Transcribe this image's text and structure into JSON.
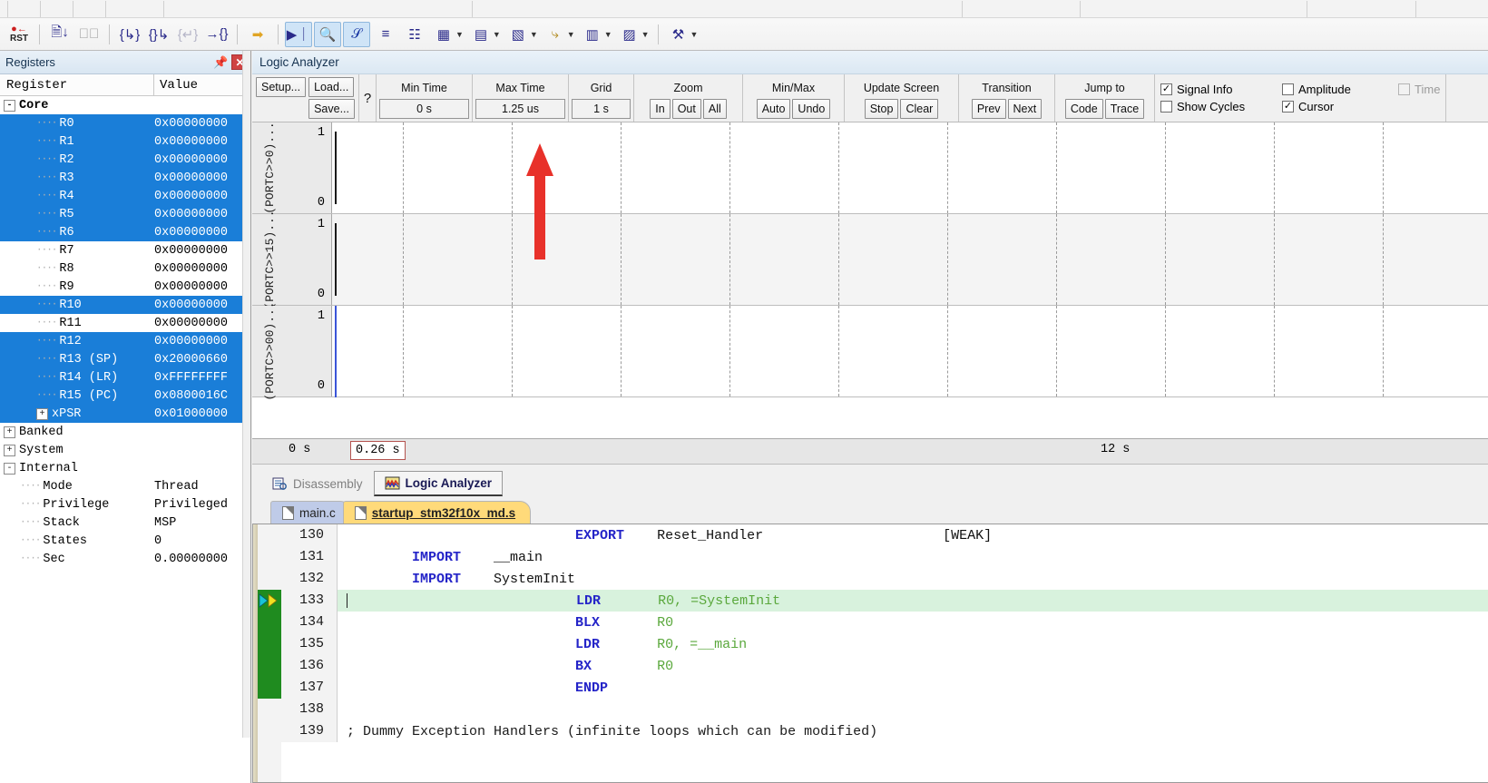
{
  "toolbar": {
    "buttons": [
      {
        "name": "reset-cpu",
        "glyph": "RST"
      },
      {
        "name": "run-to-cursor",
        "glyph": "⤓"
      },
      {
        "name": "stop",
        "glyph": "⊗"
      },
      {
        "name": "step",
        "glyph": "{↴}"
      },
      {
        "name": "step-over",
        "glyph": "{}↴"
      },
      {
        "name": "step-out",
        "glyph": "{↷}"
      },
      {
        "name": "run-to-line",
        "glyph": "→{}"
      },
      {
        "name": "show-next-statement",
        "glyph": "⇨"
      },
      {
        "name": "command-window",
        "glyph": "▶"
      },
      {
        "name": "disassembly-window",
        "glyph": "⌕"
      },
      {
        "name": "symbols-window",
        "glyph": "S"
      },
      {
        "name": "registers-window",
        "glyph": "≡"
      },
      {
        "name": "call-stack-window",
        "glyph": "⚭"
      },
      {
        "name": "watch-windows",
        "glyph": "▦"
      },
      {
        "name": "memory-windows",
        "glyph": "▤"
      },
      {
        "name": "serial-windows",
        "glyph": "▧"
      },
      {
        "name": "analysis-windows",
        "glyph": "⤵"
      },
      {
        "name": "trace-windows",
        "glyph": "▥"
      },
      {
        "name": "system-viewer",
        "glyph": "▨"
      },
      {
        "name": "toolbox",
        "glyph": "⚒"
      }
    ]
  },
  "registers": {
    "title": "Registers",
    "pin_icon": "pin-icon",
    "close_icon": "close-icon",
    "columns": [
      "Register",
      "Value"
    ],
    "rows": [
      {
        "name": "Core",
        "value": "",
        "level": 0,
        "toggle": "-",
        "selected": false,
        "bold": true
      },
      {
        "name": "R0",
        "value": "0x00000000",
        "level": 2,
        "toggle": "",
        "selected": true,
        "bold": false
      },
      {
        "name": "R1",
        "value": "0x00000000",
        "level": 2,
        "toggle": "",
        "selected": true,
        "bold": false
      },
      {
        "name": "R2",
        "value": "0x00000000",
        "level": 2,
        "toggle": "",
        "selected": true,
        "bold": false
      },
      {
        "name": "R3",
        "value": "0x00000000",
        "level": 2,
        "toggle": "",
        "selected": true,
        "bold": false
      },
      {
        "name": "R4",
        "value": "0x00000000",
        "level": 2,
        "toggle": "",
        "selected": true,
        "bold": false
      },
      {
        "name": "R5",
        "value": "0x00000000",
        "level": 2,
        "toggle": "",
        "selected": true,
        "bold": false
      },
      {
        "name": "R6",
        "value": "0x00000000",
        "level": 2,
        "toggle": "",
        "selected": true,
        "bold": false
      },
      {
        "name": "R7",
        "value": "0x00000000",
        "level": 2,
        "toggle": "",
        "selected": false,
        "bold": false
      },
      {
        "name": "R8",
        "value": "0x00000000",
        "level": 2,
        "toggle": "",
        "selected": false,
        "bold": false
      },
      {
        "name": "R9",
        "value": "0x00000000",
        "level": 2,
        "toggle": "",
        "selected": false,
        "bold": false
      },
      {
        "name": "R10",
        "value": "0x00000000",
        "level": 2,
        "toggle": "",
        "selected": true,
        "bold": false
      },
      {
        "name": "R11",
        "value": "0x00000000",
        "level": 2,
        "toggle": "",
        "selected": false,
        "bold": false
      },
      {
        "name": "R12",
        "value": "0x00000000",
        "level": 2,
        "toggle": "",
        "selected": true,
        "bold": false
      },
      {
        "name": "R13 (SP)",
        "value": "0x20000660",
        "level": 2,
        "toggle": "",
        "selected": true,
        "bold": false
      },
      {
        "name": "R14 (LR)",
        "value": "0xFFFFFFFF",
        "level": 2,
        "toggle": "",
        "selected": true,
        "bold": false
      },
      {
        "name": "R15 (PC)",
        "value": "0x0800016C",
        "level": 2,
        "toggle": "",
        "selected": true,
        "bold": false
      },
      {
        "name": "xPSR",
        "value": "0x01000000",
        "level": 2,
        "toggle": "+",
        "selected": true,
        "bold": false
      },
      {
        "name": "Banked",
        "value": "",
        "level": 0,
        "toggle": "+",
        "selected": false,
        "bold": false
      },
      {
        "name": "System",
        "value": "",
        "level": 0,
        "toggle": "+",
        "selected": false,
        "bold": false
      },
      {
        "name": "Internal",
        "value": "",
        "level": 0,
        "toggle": "-",
        "selected": false,
        "bold": false
      },
      {
        "name": "Mode",
        "value": "Thread",
        "level": 1,
        "toggle": "",
        "selected": false,
        "bold": false
      },
      {
        "name": "Privilege",
        "value": "Privileged",
        "level": 1,
        "toggle": "",
        "selected": false,
        "bold": false
      },
      {
        "name": "Stack",
        "value": "MSP",
        "level": 1,
        "toggle": "",
        "selected": false,
        "bold": false
      },
      {
        "name": "States",
        "value": "0",
        "level": 1,
        "toggle": "",
        "selected": false,
        "bold": false
      },
      {
        "name": "Sec",
        "value": "0.00000000",
        "level": 1,
        "toggle": "",
        "selected": false,
        "bold": false
      }
    ]
  },
  "logic_analyzer": {
    "title": "Logic Analyzer",
    "setup_label": "Setup...",
    "load_label": "Load...",
    "save_label": "Save...",
    "help_label": "?",
    "groups": [
      {
        "label": "Min Time",
        "value": "0 s"
      },
      {
        "label": "Max Time",
        "value": "1.25 us"
      },
      {
        "label": "Grid",
        "value": "1 s"
      }
    ],
    "button_groups": [
      {
        "label": "Zoom",
        "buttons": [
          "In",
          "Out",
          "All"
        ]
      },
      {
        "label": "Min/Max",
        "buttons": [
          "Auto",
          "Undo"
        ]
      },
      {
        "label": "Update Screen",
        "buttons": [
          "Stop",
          "Clear"
        ]
      },
      {
        "label": "Transition",
        "buttons": [
          "Prev",
          "Next"
        ]
      },
      {
        "label": "Jump to",
        "buttons": [
          "Code",
          "Trace"
        ]
      }
    ],
    "checkboxes": [
      {
        "label": "Signal Info",
        "checked": true,
        "disabled": false
      },
      {
        "label": "Amplitude",
        "checked": false,
        "disabled": false
      },
      {
        "label": "Time",
        "checked": false,
        "disabled": true
      },
      {
        "label": "Show Cycles",
        "checked": false,
        "disabled": false
      },
      {
        "label": "Cursor",
        "checked": true,
        "disabled": false
      }
    ],
    "channels": [
      {
        "name": "(PORTC>>0)...",
        "max": "1",
        "min": "0"
      },
      {
        "name": "(PORTC>>15)...",
        "max": "1",
        "min": "0"
      },
      {
        "name": "(PORTC>>00)...",
        "max": "1",
        "min": "0"
      }
    ],
    "time_start": "0 s",
    "time_end": "12 s",
    "cursor_value": "0.26 s"
  },
  "view_tabs": [
    {
      "label": "Disassembly",
      "icon": "disassembly-icon",
      "active": false
    },
    {
      "label": "Logic Analyzer",
      "icon": "logic-analyzer-icon",
      "active": true
    }
  ],
  "editor": {
    "file_tabs": [
      {
        "label": "main.c",
        "active": false
      },
      {
        "label": "startup_stm32f10x_md.s",
        "active": true
      }
    ],
    "lines": [
      {
        "num": "130",
        "indent": 28,
        "mnemonic": "EXPORT",
        "operand": "Reset_Handler",
        "tail": "[WEAK]",
        "tail_indent": 22,
        "highlight": false,
        "marker": "",
        "plain": ""
      },
      {
        "num": "131",
        "indent": 8,
        "mnemonic": "IMPORT",
        "operand": "__main",
        "tail": "",
        "tail_indent": 0,
        "highlight": false,
        "marker": "",
        "plain": ""
      },
      {
        "num": "132",
        "indent": 8,
        "mnemonic": "IMPORT",
        "operand": "SystemInit",
        "tail": "",
        "tail_indent": 0,
        "highlight": false,
        "marker": "",
        "plain": ""
      },
      {
        "num": "133",
        "indent": 28,
        "mnemonic": "LDR",
        "operand": "R0, =SystemInit",
        "tail": "",
        "tail_indent": 0,
        "highlight": true,
        "marker": "pc-arrow",
        "plain": ""
      },
      {
        "num": "134",
        "indent": 28,
        "mnemonic": "BLX",
        "operand": "R0",
        "tail": "",
        "tail_indent": 0,
        "highlight": false,
        "marker": "",
        "plain": ""
      },
      {
        "num": "135",
        "indent": 28,
        "mnemonic": "LDR",
        "operand": "R0, =__main",
        "tail": "",
        "tail_indent": 0,
        "highlight": false,
        "marker": "",
        "plain": ""
      },
      {
        "num": "136",
        "indent": 28,
        "mnemonic": "BX",
        "operand": "R0",
        "tail": "",
        "tail_indent": 0,
        "highlight": false,
        "marker": "",
        "plain": ""
      },
      {
        "num": "137",
        "indent": 28,
        "mnemonic": "ENDP",
        "operand": "",
        "tail": "",
        "tail_indent": 0,
        "highlight": false,
        "marker": "",
        "plain": ""
      },
      {
        "num": "138",
        "indent": 0,
        "mnemonic": "",
        "operand": "",
        "tail": "",
        "tail_indent": 0,
        "highlight": false,
        "marker": "",
        "plain": ""
      },
      {
        "num": "139",
        "indent": 0,
        "mnemonic": "",
        "operand": "",
        "tail": "",
        "tail_indent": 0,
        "highlight": false,
        "marker": "",
        "plain": "; Dummy Exception Handlers (infinite loops which can be modified)"
      }
    ]
  },
  "colors": {
    "selection_blue": "#1a7ed8",
    "highlight_green": "#d8f2dd",
    "pc_marker_green": "#1f8b1f",
    "active_tab_yellow": "#ffda7a",
    "inactive_tab_blue": "#bfcbe8",
    "cursor_line": "#3b55d8",
    "annotation_red": "#e8312a"
  }
}
